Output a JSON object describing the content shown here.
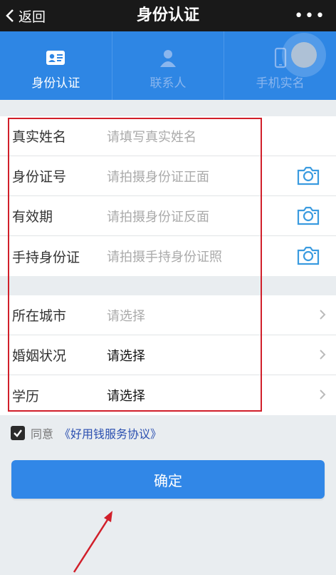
{
  "nav": {
    "back_label": "返回",
    "title": "身份认证",
    "more_label": "•••"
  },
  "tabs": [
    {
      "label": "身份认证",
      "icon": "id-card-icon",
      "active": true
    },
    {
      "label": "联系人",
      "icon": "person-icon",
      "active": false
    },
    {
      "label": "手机实名",
      "icon": "phone-icon",
      "active": false
    }
  ],
  "identity_form": [
    {
      "label": "真实姓名",
      "placeholder": "请填写真实姓名"
    },
    {
      "label": "身份证号",
      "placeholder": "请拍摄身份证正面",
      "icon": "camera-icon"
    },
    {
      "label": "有效期",
      "placeholder": "请拍摄身份证反面",
      "icon": "camera-icon"
    },
    {
      "label": "手持身份证",
      "placeholder": "请拍摄手持身份证照",
      "icon": "camera-icon"
    }
  ],
  "info_form": [
    {
      "label": "所在城市",
      "value": "请选择"
    },
    {
      "label": "婚姻状况",
      "value": "请选择"
    },
    {
      "label": "学历",
      "value": "请选择"
    }
  ],
  "agreement": {
    "checked": true,
    "text": "同意",
    "link": "《好用钱服务协议》"
  },
  "confirm_label": "确定",
  "colors": {
    "primary": "#3187e7",
    "tab_bg": "#2e86e4",
    "nav_bg": "#191919",
    "annotation": "#d11f2a"
  }
}
